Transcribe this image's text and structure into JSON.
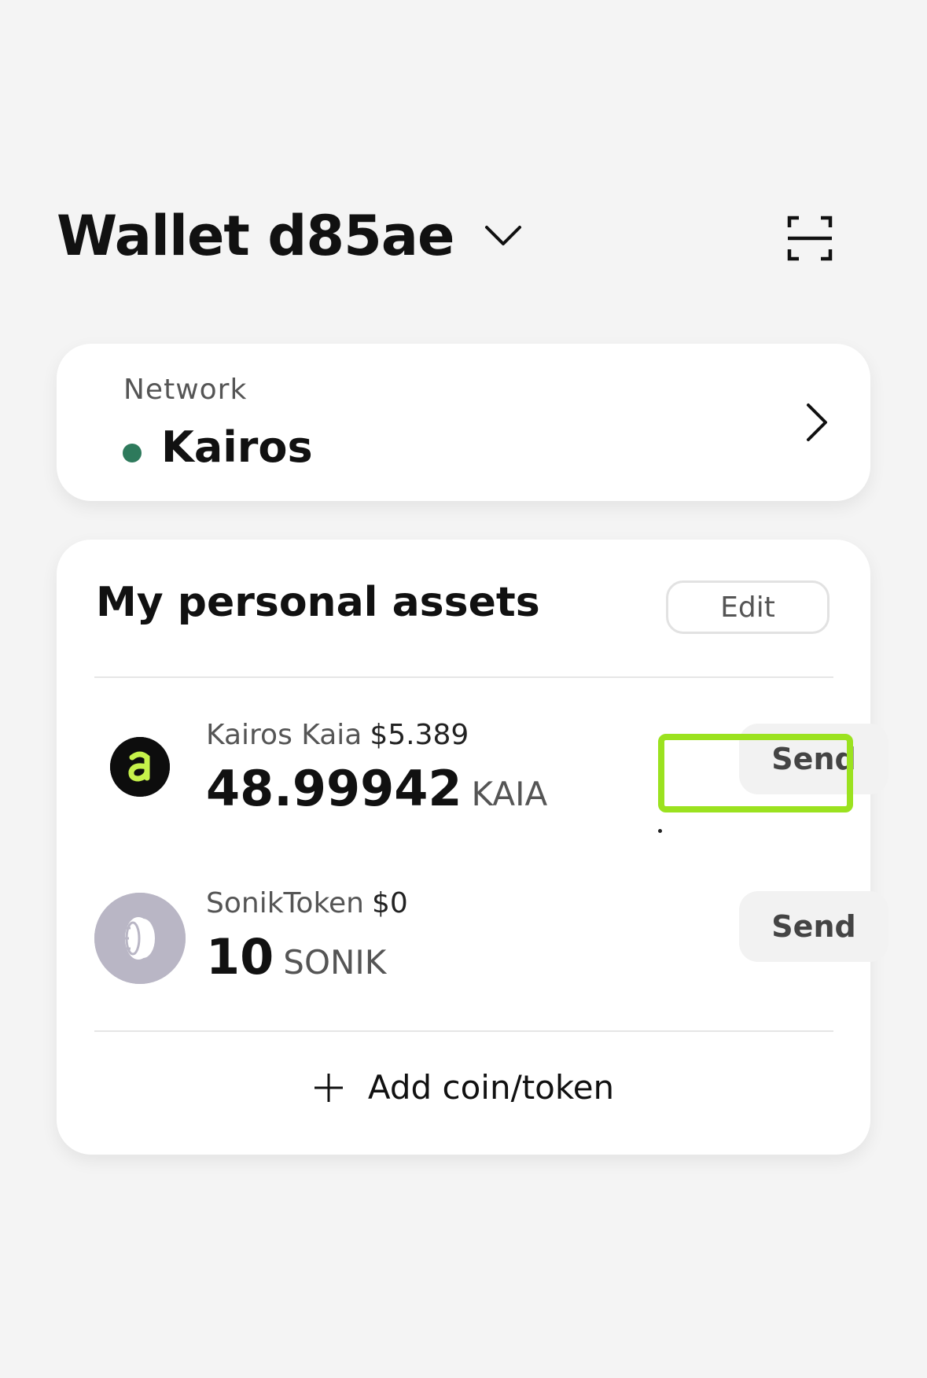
{
  "header": {
    "wallet_name": "Wallet d85ae",
    "dropdown_icon": "chevron-down-icon",
    "scan_icon": "scan-icon"
  },
  "network": {
    "label": "Network",
    "name": "Kairos",
    "status_color": "#2e7a5c"
  },
  "assets": {
    "title": "My personal assets",
    "edit_label": "Edit",
    "items": [
      {
        "name": "Kairos Kaia",
        "price": "$5.389",
        "amount": "48.99942",
        "symbol": "KAIA",
        "send_label": "Send",
        "icon": "kaia-logo-icon",
        "icon_color": "#0d0d0d",
        "icon_accent": "#c6f24a"
      },
      {
        "name": "SonikToken",
        "price": "$0",
        "amount": "10",
        "symbol": "SONIK",
        "send_label": "Send",
        "icon": "token-coin-icon",
        "icon_color": "#b9b6c5"
      }
    ],
    "add_label": "Add coin/token"
  },
  "highlight": {
    "color": "#9be21f"
  }
}
